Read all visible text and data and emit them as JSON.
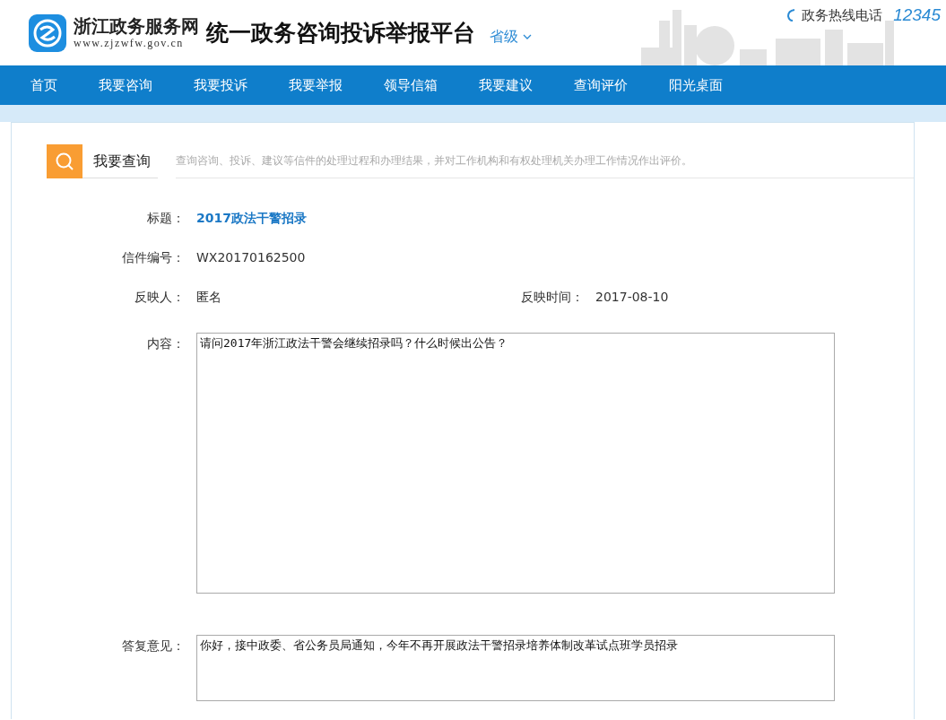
{
  "header": {
    "site_name": "浙江政务服务网",
    "site_url": "www.zjzwfw.gov.cn",
    "platform_title": "统一政务咨询投诉举报平台",
    "region": "省级",
    "hotline_label": "政务热线电话",
    "hotline_number": "12345"
  },
  "nav": [
    {
      "label": "首页",
      "selected": false
    },
    {
      "label": "我要咨询",
      "selected": false
    },
    {
      "label": "我要投诉",
      "selected": false
    },
    {
      "label": "我要举报",
      "selected": false
    },
    {
      "label": "领导信箱",
      "selected": false
    },
    {
      "label": "我要建议",
      "selected": false
    },
    {
      "label": "查询评价",
      "selected": false
    },
    {
      "label": "阳光桌面",
      "selected": false
    }
  ],
  "section": {
    "title": "我要查询",
    "description": "查询咨询、投诉、建议等信件的处理过程和办理结果，并对工作机构和有权处理机关办理工作情况作出评价。"
  },
  "letter": {
    "title_label": "标题：",
    "title": "2017政法干警招录",
    "number_label": "信件编号：",
    "number": "WX20170162500",
    "reporter_label": "反映人：",
    "reporter": "匿名",
    "time_label": "反映时间：",
    "time": "2017-08-10",
    "content_label": "内容：",
    "content": "请问2017年浙江政法干警会继续招录吗？什么时候出公告？",
    "reply_label": "答复意见：",
    "reply": "你好，接中政委、省公务员局通知，今年不再开展政法干警招录培养体制改革试点班学员招录"
  }
}
